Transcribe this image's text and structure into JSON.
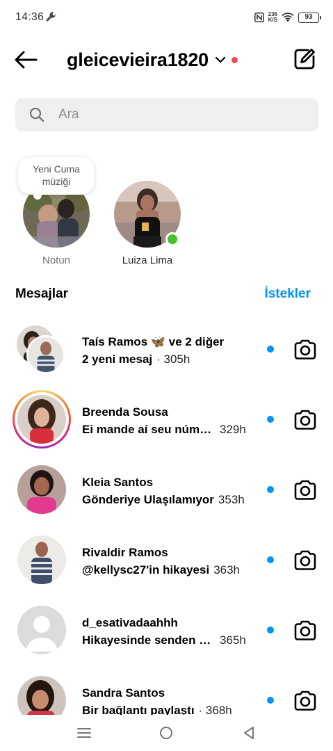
{
  "status_bar": {
    "time": "14:36",
    "net_speed_value": "236",
    "net_speed_unit": "K/S",
    "battery": "93",
    "icons": [
      "wrench-icon",
      "nfc-icon",
      "wifi-icon",
      "battery-icon"
    ]
  },
  "header": {
    "username": "gleicevieira1820",
    "icons": [
      "arrow-left-icon",
      "chevron-down-icon",
      "edit-icon"
    ]
  },
  "search": {
    "placeholder": "Ara"
  },
  "notes": [
    {
      "label": "Notun",
      "bubble": "Yeni Cuma müziği"
    },
    {
      "label": "Luiza Lima"
    }
  ],
  "messages": {
    "title": "Mesajlar",
    "requests_label": "İstekler"
  },
  "threads": [
    {
      "name": "Taís Ramos 🦋 ve 2 diğer",
      "preview": "2 yeni mesaj",
      "time": "· 305h"
    },
    {
      "name": "Breenda Sousa",
      "preview": "Ei mande aí seu número",
      "time": "329h"
    },
    {
      "name": "Kleia Santos",
      "preview": "Gönderiye Ulaşılamıyor",
      "time": "353h"
    },
    {
      "name": "Rivaldir Ramos",
      "preview": "@kellysc27'in hikayesi",
      "time": "363h"
    },
    {
      "name": "d_esativadaahhh",
      "preview": "Hikayesinde senden bahsetti",
      "time": "365h"
    },
    {
      "name": "Sandra Santos",
      "preview": "Bir bağlantı paylaştı",
      "time": "· 368h"
    }
  ],
  "colors": {
    "accent": "#0095f6",
    "online": "#44c12c",
    "notification": "#ed4956",
    "search_bg": "#efefef"
  }
}
